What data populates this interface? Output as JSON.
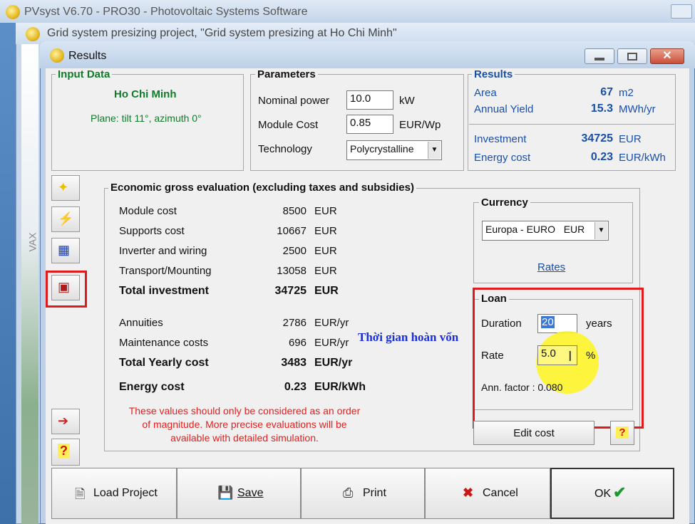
{
  "bg": {
    "app_title": "PVsyst V6.70 - PRO30 - Photovoltaic Systems Software",
    "project_title": "Grid system presizing project, \"Grid system presizing  at  Ho Chi Minh\"",
    "side_text": "VAX"
  },
  "window": {
    "title": "Results"
  },
  "input_data": {
    "title": "Input Data",
    "site": "Ho Chi Minh",
    "plane": "Plane: tilt 11°, azimuth 0°"
  },
  "parameters": {
    "title": "Parameters",
    "nominal_power_label": "Nominal power",
    "nominal_power_value": "10.0",
    "nominal_power_unit": "kW",
    "module_cost_label": "Module Cost",
    "module_cost_value": "0.85",
    "module_cost_unit": "EUR/Wp",
    "technology_label": "Technology",
    "technology_value": "Polycrystalline"
  },
  "results": {
    "title": "Results",
    "area_label": "Area",
    "area_value": "67",
    "area_unit": "m2",
    "yield_label": "Annual Yield",
    "yield_value": "15.3",
    "yield_unit": "MWh/yr",
    "investment_label": "Investment",
    "investment_value": "34725",
    "investment_unit": "EUR",
    "energy_cost_label": "Energy cost",
    "energy_cost_value": "0.23",
    "energy_cost_unit": "EUR/kWh"
  },
  "economic": {
    "title": "Economic gross evaluation   (excluding taxes and subsidies)",
    "rows": [
      {
        "label": "Module cost",
        "value": "8500",
        "unit": "EUR"
      },
      {
        "label": "Supports cost",
        "value": "10667",
        "unit": "EUR"
      },
      {
        "label": "Inverter and wiring",
        "value": "2500",
        "unit": "EUR"
      },
      {
        "label": "Transport/Mounting",
        "value": "13058",
        "unit": "EUR"
      },
      {
        "label": "Total investment",
        "value": "34725",
        "unit": "EUR"
      },
      {
        "label": "Annuities",
        "value": "2786",
        "unit": "EUR/yr"
      },
      {
        "label": "Maintenance costs",
        "value": "696",
        "unit": "EUR/yr"
      },
      {
        "label": "Total Yearly cost",
        "value": "3483",
        "unit": "EUR/yr"
      },
      {
        "label": "Energy cost",
        "value": "0.23",
        "unit": "EUR/kWh"
      }
    ],
    "note_line1": "These values should only be considered as an order",
    "note_line2": "of magnitude. More precise evaluations will be",
    "note_line3": "available with detailed simulation."
  },
  "currency": {
    "title": "Currency",
    "selected": "Europa - EURO   EUR",
    "rates_link": "Rates"
  },
  "loan": {
    "title": "Loan",
    "duration_label": "Duration",
    "duration_value": "20",
    "duration_unit": "years",
    "rate_label": "Rate",
    "rate_value": "5.0",
    "rate_unit": "%",
    "ann_factor": "Ann. factor :  0.080"
  },
  "annotation": {
    "text": "Thời gian hoàn vốn"
  },
  "buttons": {
    "edit_cost": "Edit cost",
    "help": "?",
    "load_project": "Load Project",
    "save": "Save",
    "print": "Print",
    "cancel": "Cancel",
    "ok": "OK"
  },
  "colors": {
    "accent_red": "#e01b1b",
    "green_label": "#117a2b",
    "blue_label": "#1a4fa8",
    "annotation_blue": "#1a2fd8"
  }
}
